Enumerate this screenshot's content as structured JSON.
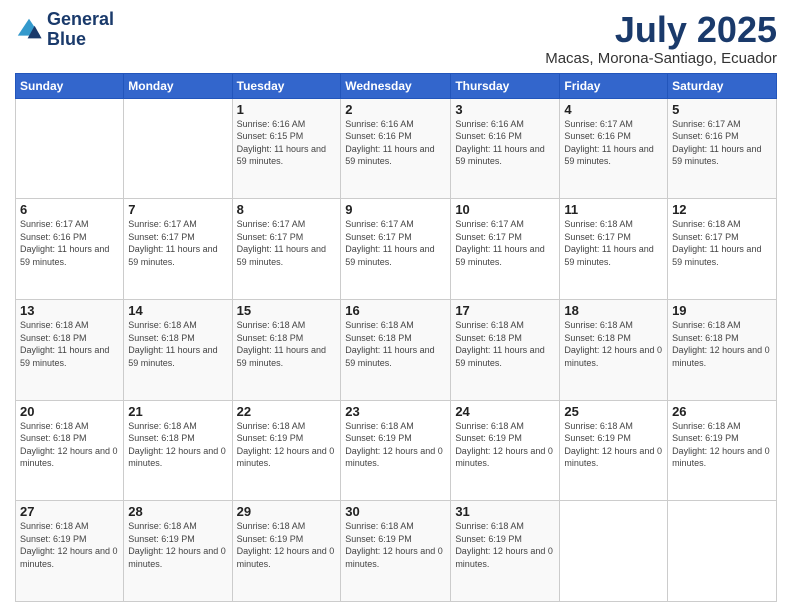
{
  "logo": {
    "line1": "General",
    "line2": "Blue"
  },
  "title": "July 2025",
  "subtitle": "Macas, Morona-Santiago, Ecuador",
  "weekdays": [
    "Sunday",
    "Monday",
    "Tuesday",
    "Wednesday",
    "Thursday",
    "Friday",
    "Saturday"
  ],
  "weeks": [
    [
      {
        "day": "",
        "info": ""
      },
      {
        "day": "",
        "info": ""
      },
      {
        "day": "1",
        "info": "Sunrise: 6:16 AM\nSunset: 6:15 PM\nDaylight: 11 hours and 59 minutes."
      },
      {
        "day": "2",
        "info": "Sunrise: 6:16 AM\nSunset: 6:16 PM\nDaylight: 11 hours and 59 minutes."
      },
      {
        "day": "3",
        "info": "Sunrise: 6:16 AM\nSunset: 6:16 PM\nDaylight: 11 hours and 59 minutes."
      },
      {
        "day": "4",
        "info": "Sunrise: 6:17 AM\nSunset: 6:16 PM\nDaylight: 11 hours and 59 minutes."
      },
      {
        "day": "5",
        "info": "Sunrise: 6:17 AM\nSunset: 6:16 PM\nDaylight: 11 hours and 59 minutes."
      }
    ],
    [
      {
        "day": "6",
        "info": "Sunrise: 6:17 AM\nSunset: 6:16 PM\nDaylight: 11 hours and 59 minutes."
      },
      {
        "day": "7",
        "info": "Sunrise: 6:17 AM\nSunset: 6:17 PM\nDaylight: 11 hours and 59 minutes."
      },
      {
        "day": "8",
        "info": "Sunrise: 6:17 AM\nSunset: 6:17 PM\nDaylight: 11 hours and 59 minutes."
      },
      {
        "day": "9",
        "info": "Sunrise: 6:17 AM\nSunset: 6:17 PM\nDaylight: 11 hours and 59 minutes."
      },
      {
        "day": "10",
        "info": "Sunrise: 6:17 AM\nSunset: 6:17 PM\nDaylight: 11 hours and 59 minutes."
      },
      {
        "day": "11",
        "info": "Sunrise: 6:18 AM\nSunset: 6:17 PM\nDaylight: 11 hours and 59 minutes."
      },
      {
        "day": "12",
        "info": "Sunrise: 6:18 AM\nSunset: 6:17 PM\nDaylight: 11 hours and 59 minutes."
      }
    ],
    [
      {
        "day": "13",
        "info": "Sunrise: 6:18 AM\nSunset: 6:18 PM\nDaylight: 11 hours and 59 minutes."
      },
      {
        "day": "14",
        "info": "Sunrise: 6:18 AM\nSunset: 6:18 PM\nDaylight: 11 hours and 59 minutes."
      },
      {
        "day": "15",
        "info": "Sunrise: 6:18 AM\nSunset: 6:18 PM\nDaylight: 11 hours and 59 minutes."
      },
      {
        "day": "16",
        "info": "Sunrise: 6:18 AM\nSunset: 6:18 PM\nDaylight: 11 hours and 59 minutes."
      },
      {
        "day": "17",
        "info": "Sunrise: 6:18 AM\nSunset: 6:18 PM\nDaylight: 11 hours and 59 minutes."
      },
      {
        "day": "18",
        "info": "Sunrise: 6:18 AM\nSunset: 6:18 PM\nDaylight: 12 hours and 0 minutes."
      },
      {
        "day": "19",
        "info": "Sunrise: 6:18 AM\nSunset: 6:18 PM\nDaylight: 12 hours and 0 minutes."
      }
    ],
    [
      {
        "day": "20",
        "info": "Sunrise: 6:18 AM\nSunset: 6:18 PM\nDaylight: 12 hours and 0 minutes."
      },
      {
        "day": "21",
        "info": "Sunrise: 6:18 AM\nSunset: 6:18 PM\nDaylight: 12 hours and 0 minutes."
      },
      {
        "day": "22",
        "info": "Sunrise: 6:18 AM\nSunset: 6:19 PM\nDaylight: 12 hours and 0 minutes."
      },
      {
        "day": "23",
        "info": "Sunrise: 6:18 AM\nSunset: 6:19 PM\nDaylight: 12 hours and 0 minutes."
      },
      {
        "day": "24",
        "info": "Sunrise: 6:18 AM\nSunset: 6:19 PM\nDaylight: 12 hours and 0 minutes."
      },
      {
        "day": "25",
        "info": "Sunrise: 6:18 AM\nSunset: 6:19 PM\nDaylight: 12 hours and 0 minutes."
      },
      {
        "day": "26",
        "info": "Sunrise: 6:18 AM\nSunset: 6:19 PM\nDaylight: 12 hours and 0 minutes."
      }
    ],
    [
      {
        "day": "27",
        "info": "Sunrise: 6:18 AM\nSunset: 6:19 PM\nDaylight: 12 hours and 0 minutes."
      },
      {
        "day": "28",
        "info": "Sunrise: 6:18 AM\nSunset: 6:19 PM\nDaylight: 12 hours and 0 minutes."
      },
      {
        "day": "29",
        "info": "Sunrise: 6:18 AM\nSunset: 6:19 PM\nDaylight: 12 hours and 0 minutes."
      },
      {
        "day": "30",
        "info": "Sunrise: 6:18 AM\nSunset: 6:19 PM\nDaylight: 12 hours and 0 minutes."
      },
      {
        "day": "31",
        "info": "Sunrise: 6:18 AM\nSunset: 6:19 PM\nDaylight: 12 hours and 0 minutes."
      },
      {
        "day": "",
        "info": ""
      },
      {
        "day": "",
        "info": ""
      }
    ]
  ]
}
